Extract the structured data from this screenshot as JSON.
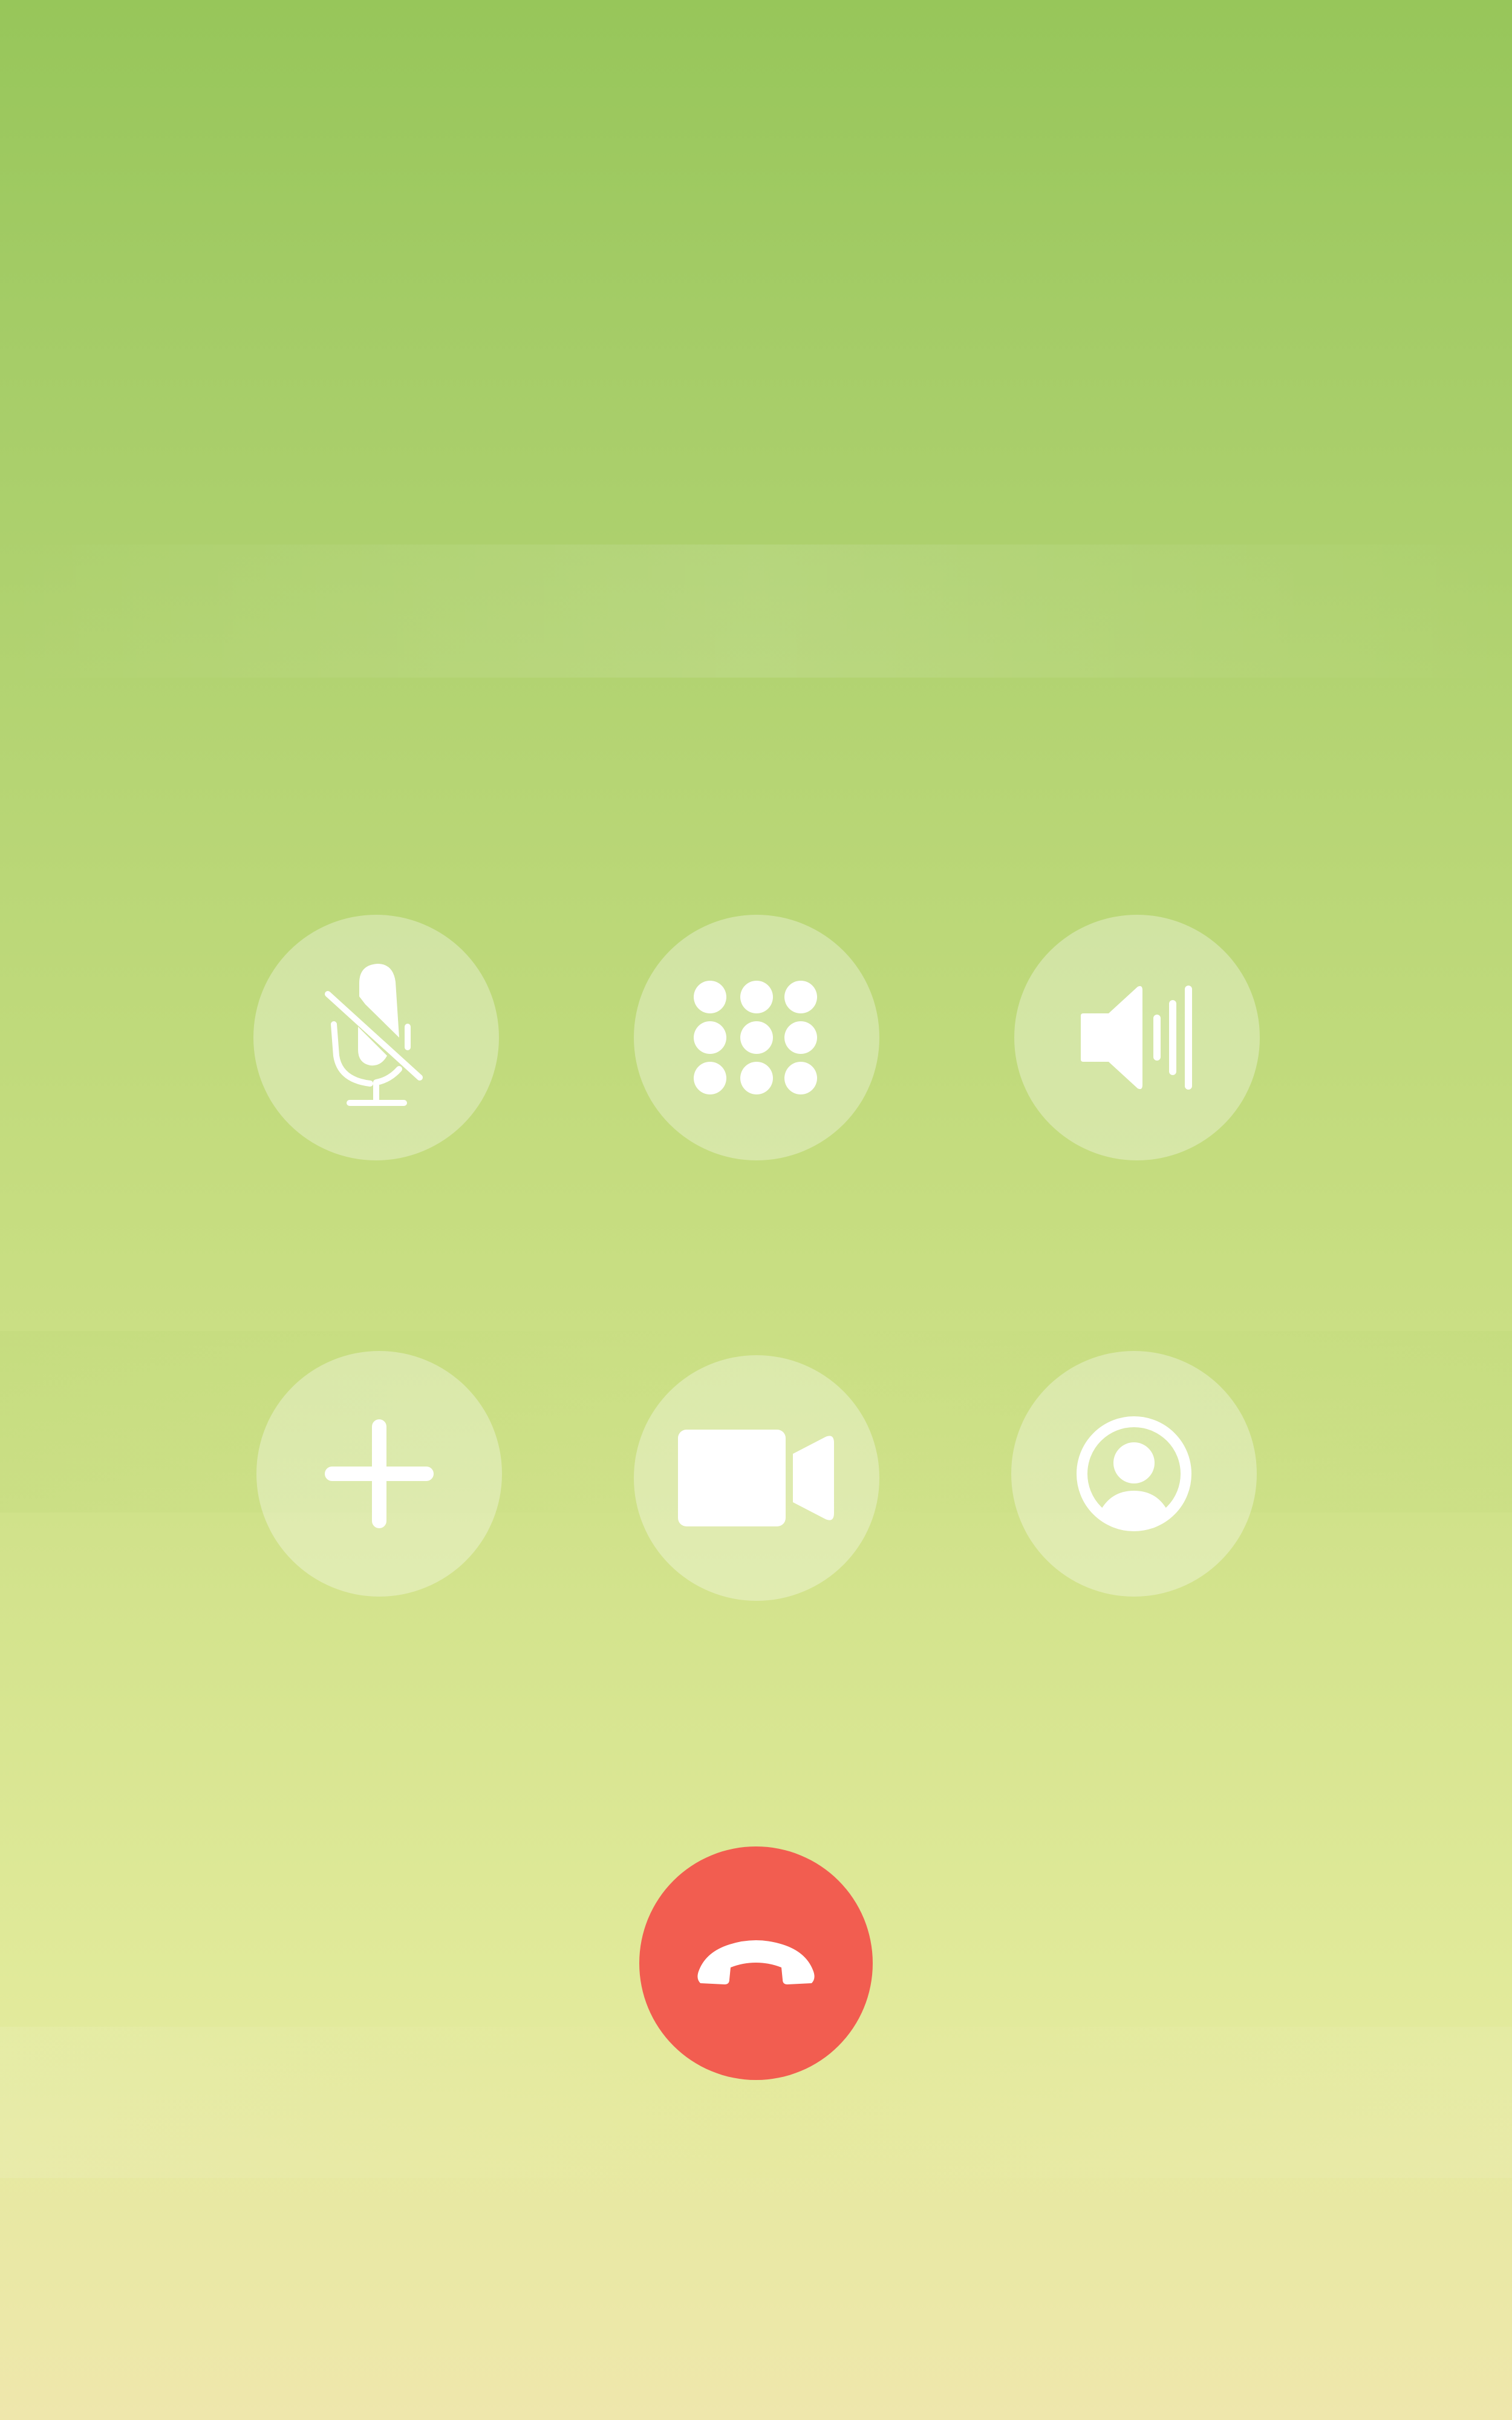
{
  "colors": {
    "control_bg": "rgba(255,255,255,0.32)",
    "icon": "#ffffff",
    "end_call": "#f25d50",
    "background_top": "#97c65a",
    "background_bottom": "#efe7ac"
  },
  "controls": [
    {
      "id": "mute",
      "icon": "mic-off-icon",
      "label": ""
    },
    {
      "id": "keypad",
      "icon": "keypad-icon",
      "label": ""
    },
    {
      "id": "speaker",
      "icon": "speaker-icon",
      "label": ""
    },
    {
      "id": "add",
      "icon": "plus-icon",
      "label": ""
    },
    {
      "id": "video",
      "icon": "video-camera-icon",
      "label": ""
    },
    {
      "id": "contact",
      "icon": "person-circle-icon",
      "label": ""
    }
  ],
  "end_call": {
    "icon": "phone-hangup-icon",
    "label": ""
  }
}
